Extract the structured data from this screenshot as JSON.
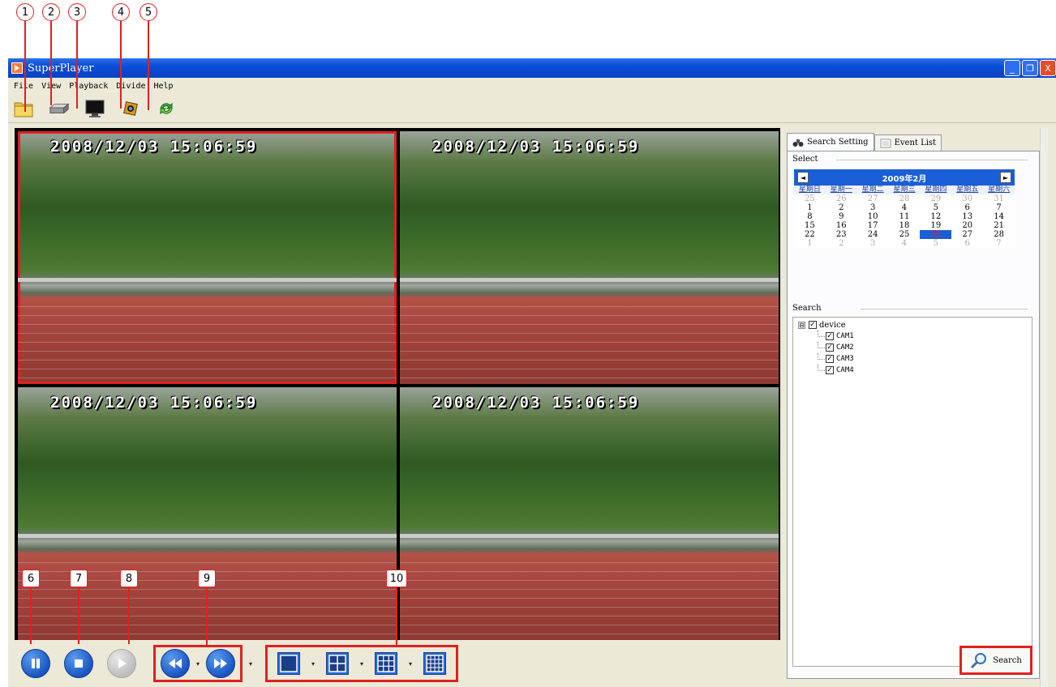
{
  "callouts": {
    "top": [
      "1",
      "2",
      "3",
      "4",
      "5"
    ],
    "bottom": [
      "6",
      "7",
      "8",
      "9",
      "10"
    ]
  },
  "window": {
    "title": "SuperPlayer",
    "minimize": "_",
    "restore": "❐",
    "close": "X"
  },
  "menu": [
    "File",
    "View",
    "Playback",
    "Divide",
    "Help"
  ],
  "toolbar_icons": [
    "folder-icon",
    "dvr-device-icon",
    "monitor-icon",
    "camera-settings-icon",
    "refresh-icon"
  ],
  "video": {
    "timestamps": [
      "2008/12/03 15:06:59",
      "2008/12/03 15:06:59",
      "2008/12/03 15:06:59",
      "2008/12/03 15:06:59"
    ],
    "selected_channel": 1
  },
  "controls": {
    "pause": "pause-icon",
    "stop": "stop-icon",
    "play": "play-icon",
    "rewind": "rewind-icon",
    "fast_forward": "fast-forward-icon",
    "dropdown": "▾",
    "layouts": [
      "split-1-icon",
      "split-4-icon",
      "split-9-icon",
      "split-16-icon"
    ]
  },
  "panel": {
    "tabs": [
      "Search Setting",
      "Event List"
    ],
    "select_label": "Select",
    "search_label": "Search",
    "search_button": "Search",
    "calendar": {
      "title": "2009年2月",
      "prev": "◄",
      "next": "►",
      "weekdays": [
        "星期日",
        "星期一",
        "星期二",
        "星期三",
        "星期四",
        "星期五",
        "星期六"
      ],
      "days": [
        {
          "d": "25",
          "o": true
        },
        {
          "d": "26",
          "o": true
        },
        {
          "d": "27",
          "o": true
        },
        {
          "d": "28",
          "o": true
        },
        {
          "d": "29",
          "o": true
        },
        {
          "d": "30",
          "o": true
        },
        {
          "d": "31",
          "o": true
        },
        {
          "d": "1"
        },
        {
          "d": "2"
        },
        {
          "d": "3"
        },
        {
          "d": "4"
        },
        {
          "d": "5"
        },
        {
          "d": "6"
        },
        {
          "d": "7"
        },
        {
          "d": "8"
        },
        {
          "d": "9"
        },
        {
          "d": "10"
        },
        {
          "d": "11"
        },
        {
          "d": "12"
        },
        {
          "d": "13"
        },
        {
          "d": "14"
        },
        {
          "d": "15"
        },
        {
          "d": "16"
        },
        {
          "d": "17"
        },
        {
          "d": "18"
        },
        {
          "d": "19"
        },
        {
          "d": "20"
        },
        {
          "d": "21"
        },
        {
          "d": "22"
        },
        {
          "d": "23"
        },
        {
          "d": "24"
        },
        {
          "d": "25"
        },
        {
          "d": "26",
          "t": true
        },
        {
          "d": "27"
        },
        {
          "d": "28"
        },
        {
          "d": "1",
          "o": true
        },
        {
          "d": "2",
          "o": true
        },
        {
          "d": "3",
          "o": true
        },
        {
          "d": "4",
          "o": true
        },
        {
          "d": "5",
          "o": true
        },
        {
          "d": "6",
          "o": true
        },
        {
          "d": "7",
          "o": true
        }
      ]
    },
    "tree": {
      "collapse": "⊟",
      "root": "device",
      "children": [
        "CAM1",
        "CAM2",
        "CAM3",
        "CAM4"
      ],
      "check": "✓"
    }
  },
  "colors": {
    "annotation": "#e02020",
    "titlebar": "#0a4cd6",
    "control_blue": "#1a56c2"
  }
}
